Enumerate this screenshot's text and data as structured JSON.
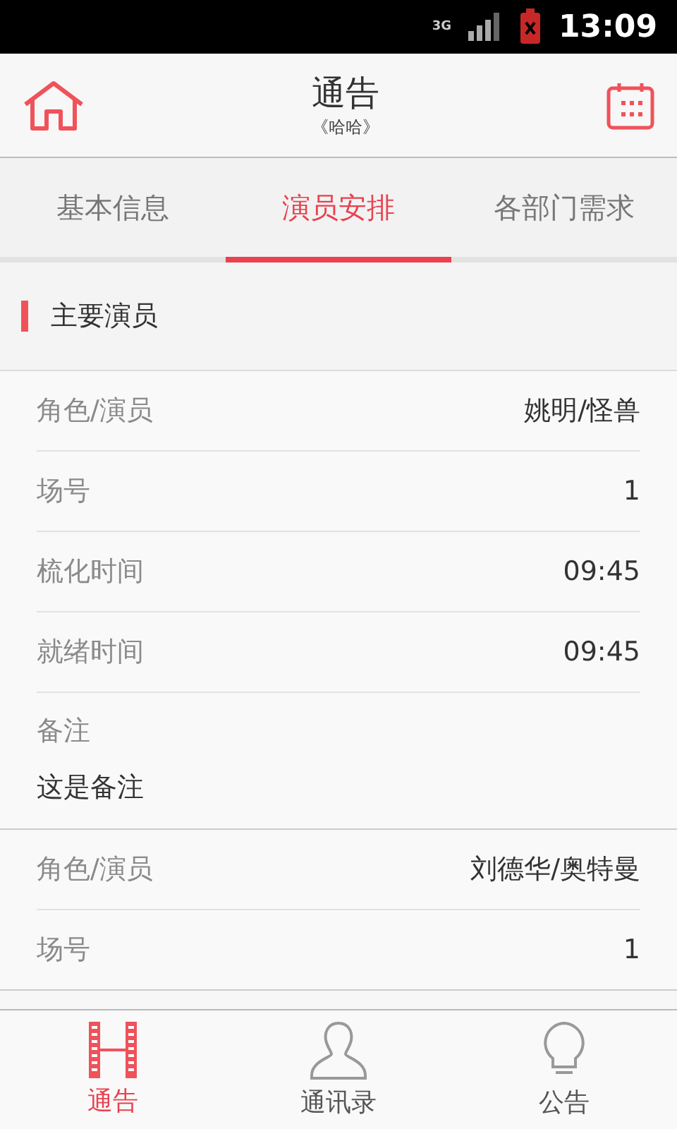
{
  "status_bar": {
    "network": "3G",
    "time": "13:09"
  },
  "header": {
    "title": "通告",
    "subtitle": "《哈哈》"
  },
  "tabs": [
    {
      "label": "基本信息",
      "selected": false
    },
    {
      "label": "演员安排",
      "selected": true
    },
    {
      "label": "各部门需求",
      "selected": false
    }
  ],
  "section": {
    "title": "主要演员"
  },
  "groups": [
    {
      "rows": [
        {
          "kind": "field",
          "label": "角色/演员",
          "value": "姚明/怪兽"
        },
        {
          "kind": "field",
          "label": "场号",
          "value": "1"
        },
        {
          "kind": "field",
          "label": "梳化时间",
          "value": "09:45"
        },
        {
          "kind": "field",
          "label": "就绪时间",
          "value": "09:45"
        },
        {
          "kind": "note",
          "label": "备注",
          "value": "这是备注"
        }
      ]
    },
    {
      "rows": [
        {
          "kind": "field",
          "label": "角色/演员",
          "value": "刘德华/奥特曼"
        },
        {
          "kind": "field",
          "label": "场号",
          "value": "1"
        }
      ]
    }
  ],
  "bottom_nav": [
    {
      "label": "通告",
      "kind": "film",
      "selected": true
    },
    {
      "label": "通讯录",
      "kind": "person",
      "selected": false
    },
    {
      "label": "公告",
      "kind": "bulb",
      "selected": false
    }
  ]
}
